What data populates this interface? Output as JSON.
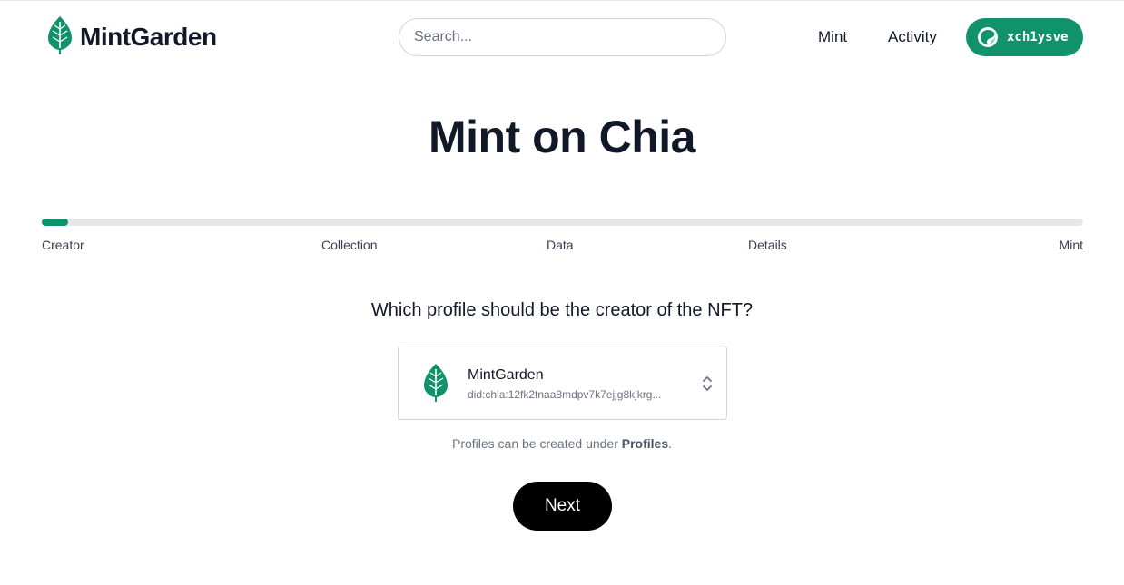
{
  "header": {
    "logo_text": "MintGarden",
    "search_placeholder": "Search...",
    "nav": {
      "mint": "Mint",
      "activity": "Activity"
    },
    "wallet_label": "xch1ysve"
  },
  "page": {
    "title": "Mint on Chia"
  },
  "progress": {
    "fraction": 0.025,
    "steps": [
      "Creator",
      "Collection",
      "Data",
      "Details",
      "Mint"
    ],
    "current_step": "Creator"
  },
  "creator": {
    "question": "Which profile should be the creator of the NFT?",
    "selected_profile": {
      "name": "MintGarden",
      "did": "did:chia:12fk2tnaa8mdpv7k7ejjg8kjkrg..."
    },
    "hint_prefix": "Profiles can be created under ",
    "hint_link": "Profiles",
    "hint_suffix": "."
  },
  "actions": {
    "next_label": "Next"
  },
  "icons": {
    "logo": "leaf-icon",
    "wallet": "wallet-avatar-icon",
    "profile": "leaf-icon",
    "select": "chevron-up-down-icon"
  },
  "colors": {
    "brand_green": "#10936b",
    "text_dark": "#111827",
    "muted": "#6b7280",
    "next_button": "#000000"
  }
}
